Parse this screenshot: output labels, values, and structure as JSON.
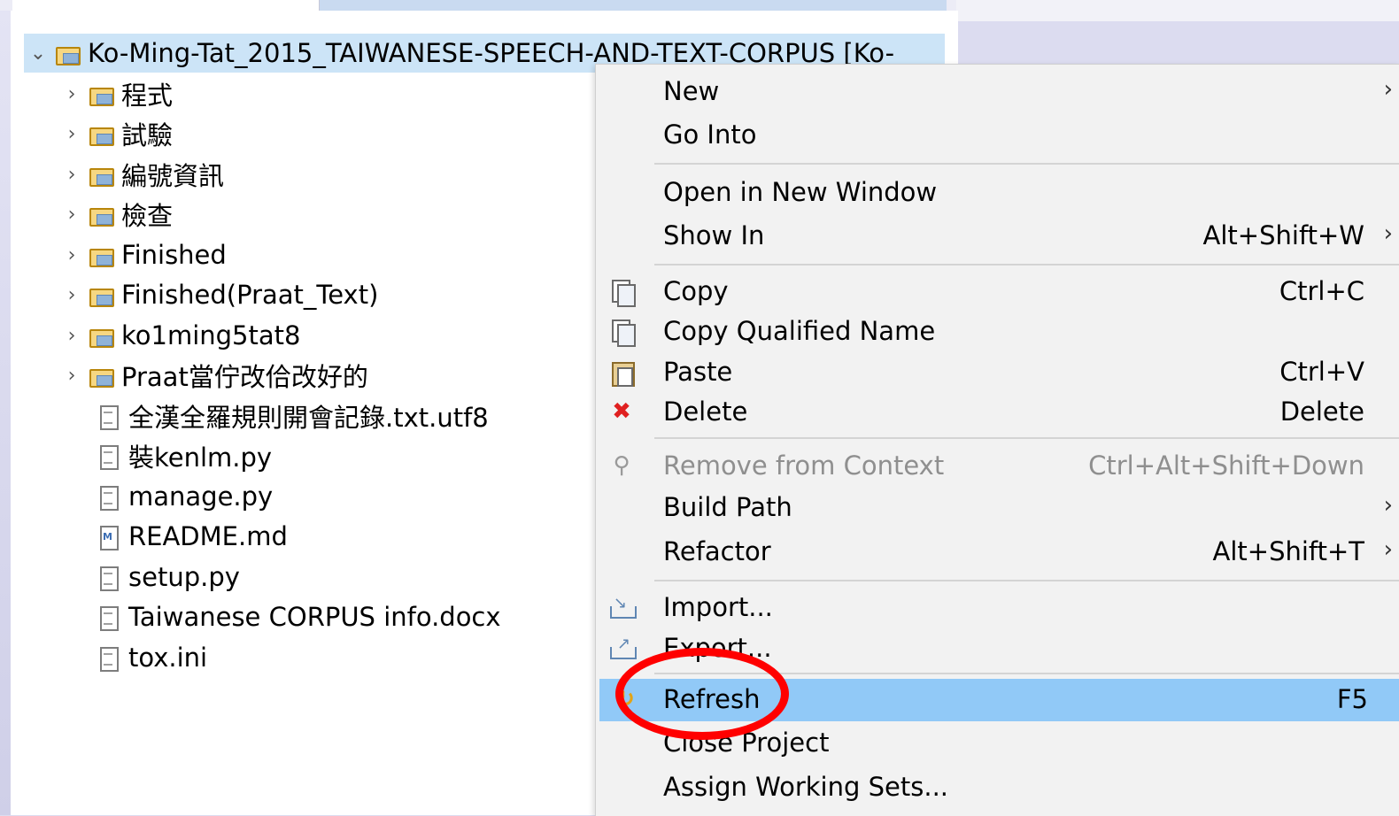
{
  "explorer": {
    "root": "Ko-Ming-Tat_2015_TAIWANESE-SPEECH-AND-TEXT-CORPUS [Ko-",
    "folders": [
      "程式",
      "試驗",
      "編號資訊",
      "檢查",
      "Finished",
      "Finished(Praat_Text)",
      "ko1ming5tat8",
      "Praat當佇改佮改好的"
    ],
    "files": [
      "全漢全羅規則開會記錄.txt.utf8",
      "裝kenlm.py",
      "manage.py",
      "README.md",
      "setup.py",
      "Taiwanese CORPUS info.docx",
      "tox.ini"
    ]
  },
  "context_menu": {
    "items": [
      {
        "label": "New",
        "shortcut": "",
        "submenu": true
      },
      {
        "label": "Go Into",
        "shortcut": ""
      },
      {
        "label": "Open in New Window",
        "shortcut": ""
      },
      {
        "label": "Show In",
        "shortcut": "Alt+Shift+W",
        "submenu": true
      },
      {
        "label": "Copy",
        "shortcut": "Ctrl+C"
      },
      {
        "label": "Copy Qualified Name",
        "shortcut": ""
      },
      {
        "label": "Paste",
        "shortcut": "Ctrl+V"
      },
      {
        "label": "Delete",
        "shortcut": "Delete"
      },
      {
        "label": "Remove from Context",
        "shortcut": "Ctrl+Alt+Shift+Down",
        "disabled": true
      },
      {
        "label": "Build Path",
        "shortcut": "",
        "submenu": true
      },
      {
        "label": "Refactor",
        "shortcut": "Alt+Shift+T",
        "submenu": true
      },
      {
        "label": "Import...",
        "shortcut": ""
      },
      {
        "label": "Export...",
        "shortcut": ""
      },
      {
        "label": "Refresh",
        "shortcut": "F5",
        "highlighted": true
      },
      {
        "label": "Close Project",
        "shortcut": ""
      },
      {
        "label": "Assign Working Sets...",
        "shortcut": ""
      }
    ],
    "submenu_glyph": "›"
  },
  "colors": {
    "highlight": "#91c9f7",
    "selection": "#cce4f7",
    "annotation": "#ff0000"
  }
}
